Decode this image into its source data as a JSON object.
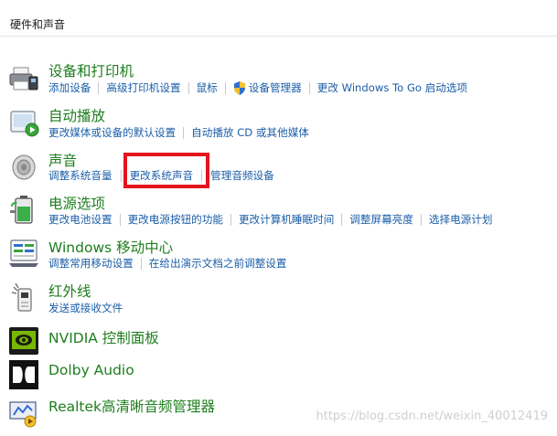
{
  "header": {
    "title": "硬件和声音"
  },
  "devices": {
    "icon": "printer-icon",
    "title": "设备和打印机",
    "links": [
      "添加设备",
      "高级打印机设置",
      "鼠标",
      "设备管理器",
      "更改 Windows To Go 启动选项"
    ]
  },
  "autoplay": {
    "icon": "autoplay-icon",
    "title": "自动播放",
    "links": [
      "更改媒体或设备的默认设置",
      "自动播放 CD 或其他媒体"
    ]
  },
  "sound": {
    "icon": "speaker-icon",
    "title": "声音",
    "links": [
      "调整系统音量",
      "更改系统声音",
      "管理音频设备"
    ]
  },
  "power": {
    "icon": "battery-icon",
    "title": "电源选项",
    "links": [
      "更改电池设置",
      "更改电源按钮的功能",
      "更改计算机睡眠时间",
      "调整屏幕亮度",
      "选择电源计划"
    ]
  },
  "mobility": {
    "icon": "mobility-center-icon",
    "title": "Windows 移动中心",
    "links": [
      "调整常用移动设置",
      "在给出演示文档之前调整设置"
    ]
  },
  "infrared": {
    "icon": "infrared-icon",
    "title": "红外线",
    "links": [
      "发送或接收文件"
    ]
  },
  "nvidia": {
    "icon": "nvidia-icon",
    "title": "NVIDIA 控制面板"
  },
  "dolby": {
    "icon": "dolby-icon",
    "title": "Dolby Audio"
  },
  "realtek": {
    "icon": "realtek-icon",
    "title": "Realtek高清晰音频管理器"
  },
  "watermark": "https://blog.csdn.net/weixin_40012419",
  "colors": {
    "title_green": "#1e7e1e",
    "link_blue": "#1b5ea8",
    "highlight_red": "#e3141c"
  }
}
